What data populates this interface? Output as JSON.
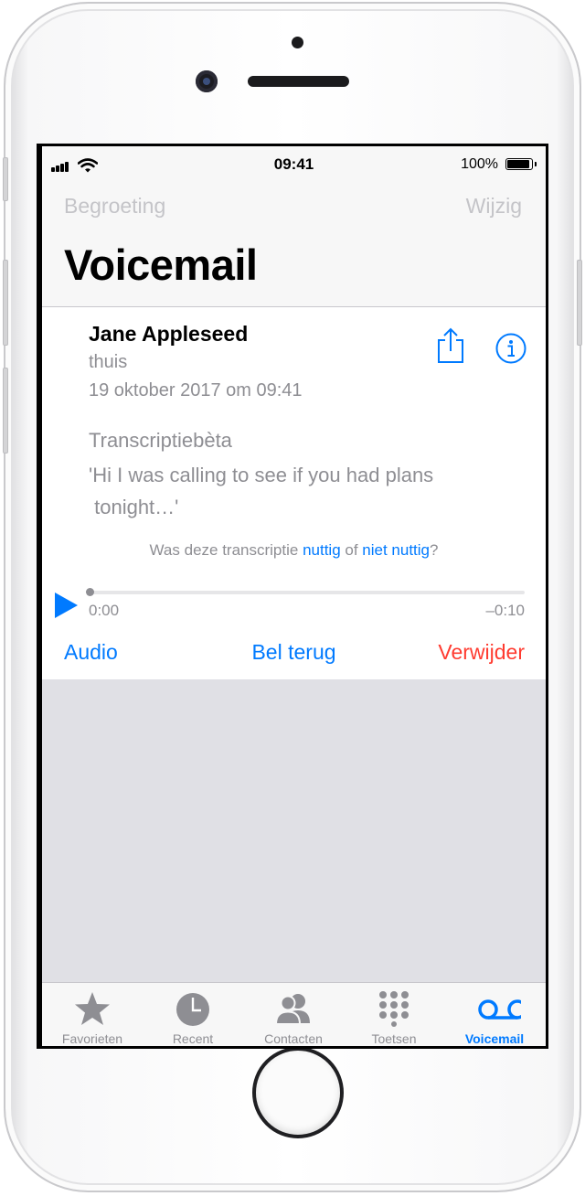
{
  "status_bar": {
    "time": "09:41",
    "battery": "100%"
  },
  "navbar": {
    "left": "Begroeting",
    "right": "Wijzig",
    "title": "Voicemail"
  },
  "voicemail": {
    "caller": "Jane Appleseed",
    "label": "thuis",
    "datetime": "19 oktober 2017 om 09:41",
    "transcription_title": "Transcriptiebèta",
    "transcription_line1": "'Hi I was calling to see if you had plans",
    "transcription_line2": " tonight…'",
    "feedback": {
      "prefix": "Was deze transcriptie ",
      "useful": "nuttig",
      "middle": " of ",
      "not_useful": "niet nuttig",
      "suffix": "?"
    },
    "player": {
      "elapsed": "0:00",
      "remaining": "–0:10",
      "progress": 0
    },
    "actions": {
      "audio": "Audio",
      "call_back": "Bel terug",
      "delete": "Verwijder"
    }
  },
  "tabs": [
    {
      "label": "Favorieten",
      "icon": "star-icon"
    },
    {
      "label": "Recent",
      "icon": "clock-icon"
    },
    {
      "label": "Contacten",
      "icon": "contacts-icon"
    },
    {
      "label": "Toetsen",
      "icon": "keypad-icon"
    },
    {
      "label": "Voicemail",
      "icon": "voicemail-icon",
      "active": true
    }
  ],
  "colors": {
    "accent": "#007aff",
    "destructive": "#ff3b30",
    "secondary_text": "#8e8e93",
    "empty_bg": "#e0e0e5"
  }
}
